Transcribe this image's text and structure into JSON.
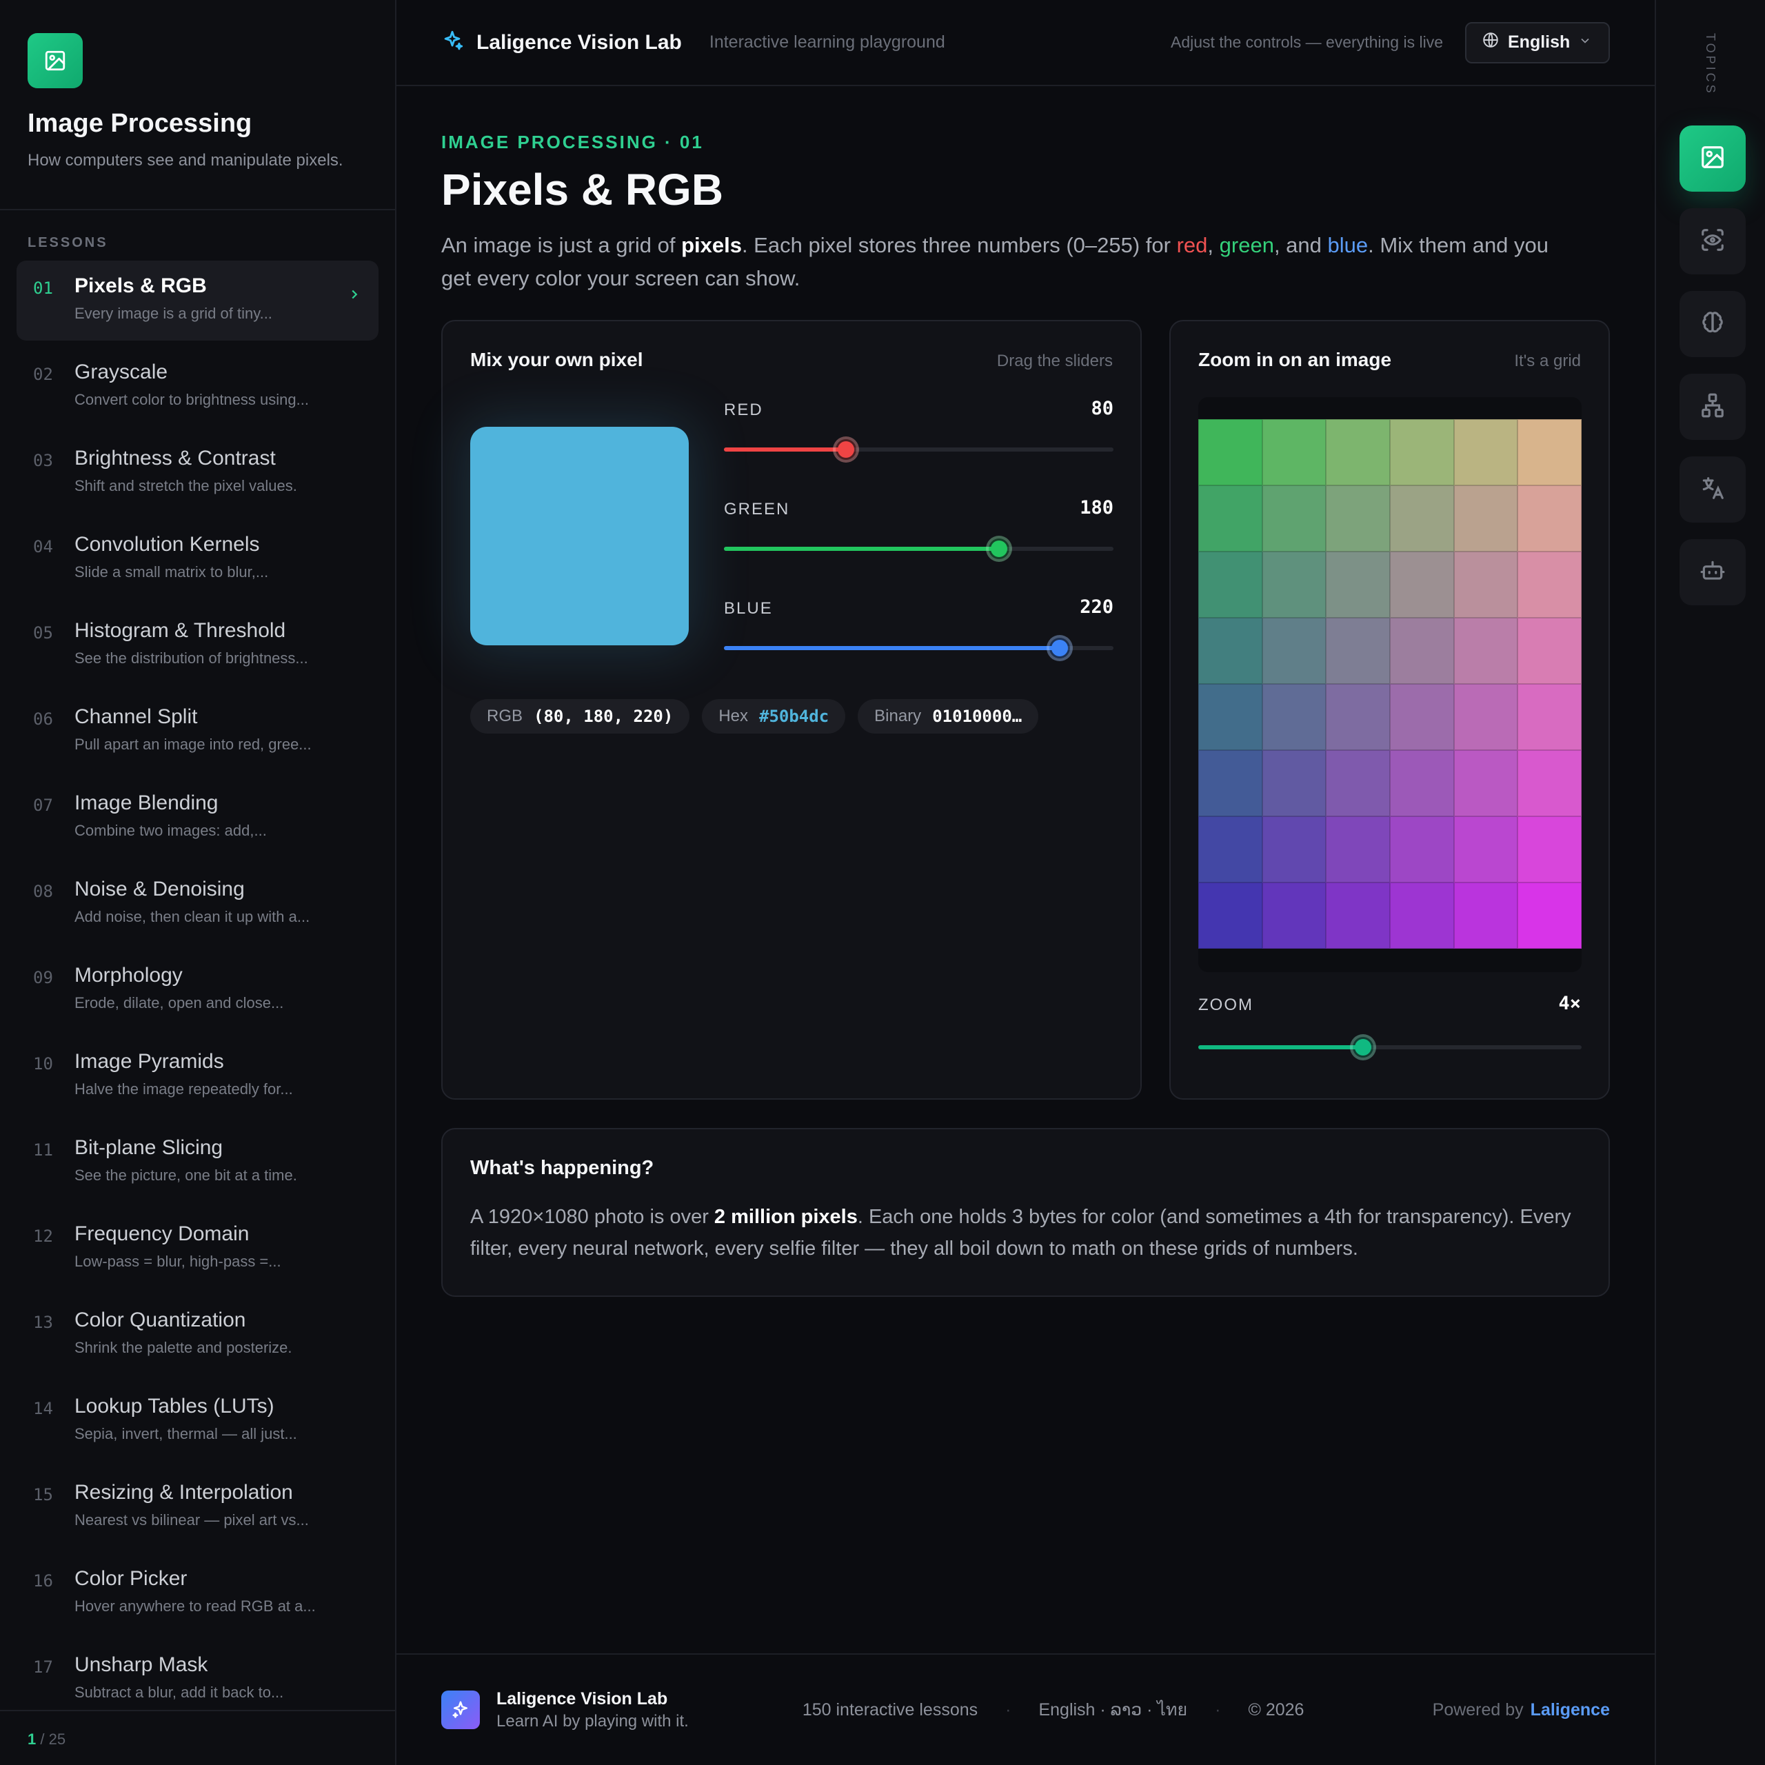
{
  "sidebar": {
    "title": "Image Processing",
    "subtitle": "How computers see and manipulate pixels.",
    "section_label": "LESSONS",
    "items": [
      {
        "num": "01",
        "title": "Pixels & RGB",
        "desc": "Every image is a grid of tiny...",
        "active": true
      },
      {
        "num": "02",
        "title": "Grayscale",
        "desc": "Convert color to brightness using..."
      },
      {
        "num": "03",
        "title": "Brightness & Contrast",
        "desc": "Shift and stretch the pixel values."
      },
      {
        "num": "04",
        "title": "Convolution Kernels",
        "desc": "Slide a small matrix to blur,..."
      },
      {
        "num": "05",
        "title": "Histogram & Threshold",
        "desc": "See the distribution of brightness..."
      },
      {
        "num": "06",
        "title": "Channel Split",
        "desc": "Pull apart an image into red, gree..."
      },
      {
        "num": "07",
        "title": "Image Blending",
        "desc": "Combine two images: add,..."
      },
      {
        "num": "08",
        "title": "Noise & Denoising",
        "desc": "Add noise, then clean it up with a..."
      },
      {
        "num": "09",
        "title": "Morphology",
        "desc": "Erode, dilate, open and close..."
      },
      {
        "num": "10",
        "title": "Image Pyramids",
        "desc": "Halve the image repeatedly for..."
      },
      {
        "num": "11",
        "title": "Bit-plane Slicing",
        "desc": "See the picture, one bit at a time."
      },
      {
        "num": "12",
        "title": "Frequency Domain",
        "desc": "Low-pass = blur, high-pass =..."
      },
      {
        "num": "13",
        "title": "Color Quantization",
        "desc": "Shrink the palette and posterize."
      },
      {
        "num": "14",
        "title": "Lookup Tables (LUTs)",
        "desc": "Sepia, invert, thermal — all just..."
      },
      {
        "num": "15",
        "title": "Resizing & Interpolation",
        "desc": "Nearest vs bilinear — pixel art vs..."
      },
      {
        "num": "16",
        "title": "Color Picker",
        "desc": "Hover anywhere to read RGB at a..."
      },
      {
        "num": "17",
        "title": "Unsharp Mask",
        "desc": "Subtract a blur, add it back to..."
      }
    ],
    "pager": {
      "current": "1",
      "total": "/ 25"
    }
  },
  "topbar": {
    "brand": "Laligence Vision Lab",
    "tagline": "Interactive learning playground",
    "hint": "Adjust the controls — everything is live",
    "language": "English"
  },
  "rail": {
    "label": "TOPICS",
    "items": [
      {
        "icon": "image-icon",
        "active": true
      },
      {
        "icon": "eye-scan-icon"
      },
      {
        "icon": "brain-icon"
      },
      {
        "icon": "network-icon"
      },
      {
        "icon": "translate-icon"
      },
      {
        "icon": "robot-icon"
      }
    ]
  },
  "lesson": {
    "eyebrow": "IMAGE PROCESSING · 01",
    "title": "Pixels & RGB",
    "intro": {
      "p1": "An image is just a grid of ",
      "b1": "pixels",
      "p2": ". Each pixel stores three numbers (0–255) for ",
      "red": "red",
      "comma1": ", ",
      "green": "green",
      "p3": ", and ",
      "blue": "blue",
      "p4": ". Mix them and you get every color your screen can show."
    }
  },
  "mixer": {
    "title": "Mix your own pixel",
    "hint": "Drag the sliders",
    "swatch_color": "#50b4dc",
    "sliders": [
      {
        "label": "RED",
        "value": 80,
        "max": 255,
        "color": "#ef4444"
      },
      {
        "label": "GREEN",
        "value": 180,
        "max": 255,
        "color": "#22c55e"
      },
      {
        "label": "BLUE",
        "value": 220,
        "max": 255,
        "color": "#3b82f6"
      }
    ],
    "chips": [
      {
        "label": "RGB",
        "value": "(80, 180, 220)"
      },
      {
        "label": "Hex",
        "value": "#50b4dc"
      },
      {
        "label": "Binary",
        "value": "01010000…"
      }
    ]
  },
  "zoom": {
    "title": "Zoom in on an image",
    "hint": "It's a grid",
    "label": "ZOOM",
    "value_text": "4×",
    "level": 0.43,
    "accent": "#10b981",
    "grid": {
      "cols": 6,
      "rows": 8,
      "top_left": "#40b65a",
      "top_right": "#d8b48c",
      "bottom_left": "#4436b0",
      "bottom_right": "#d834e8"
    }
  },
  "explain": {
    "title": "What's happening?",
    "p1": "A 1920×1080 photo is over ",
    "b1": "2 million pixels",
    "p2": ". Each one holds 3 bytes for color (and sometimes a 4th for transparency). Every filter, every neural network, every selfie filter — they all boil down to math on these grids of numbers."
  },
  "footer": {
    "brand": "Laligence Vision Lab",
    "sub": "Learn AI by playing with it.",
    "lessons": "150 interactive lessons",
    "langs": "English · ລາວ · ไทย",
    "copy": "© 2026",
    "powered": "Powered by",
    "powered_brand": "Laligence"
  }
}
